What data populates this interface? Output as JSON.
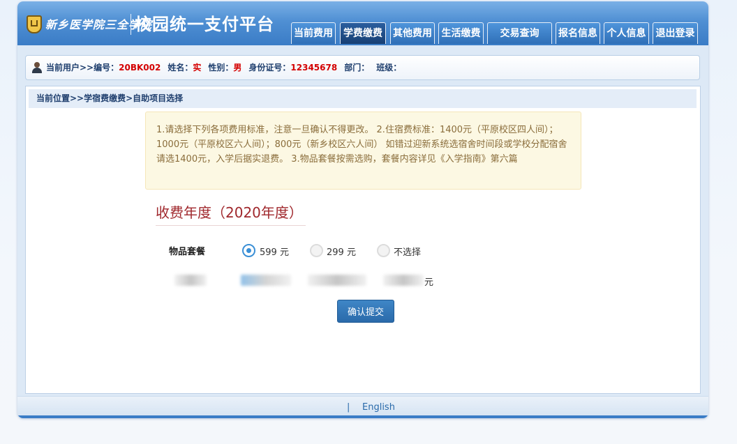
{
  "header": {
    "school_name": "新乡医学院三全学院",
    "platform_title": "校园统一支付平台"
  },
  "nav": {
    "tabs": [
      {
        "label": "当前费用",
        "active": false
      },
      {
        "label": "学费缴费",
        "active": true
      },
      {
        "label": "其他费用",
        "active": false
      },
      {
        "label": "生活缴费",
        "active": false
      },
      {
        "label": "交易查询",
        "active": false
      },
      {
        "label": "报名信息",
        "active": false
      },
      {
        "label": "个人信息",
        "active": false
      },
      {
        "label": "退出登录",
        "active": false
      }
    ]
  },
  "user": {
    "prefix": "当前用户>>编号：",
    "id": "20BK002",
    "name_label": "姓名：",
    "name": "实",
    "gender_label": "性别：",
    "gender": "男",
    "idcard_label": "身份证号：",
    "idcard": "12345678",
    "dept_label": "部门：",
    "class_label": "班级："
  },
  "breadcrumb": "当前位置>>学宿费缴费>自助项目选择",
  "notice": "1.请选择下列各项费用标准，注意一旦确认不得更改。 2.住宿费标准：1400元（平原校区四人间）；1000元（平原校区六人间）；800元（新乡校区六人间） 如错过迎新系统选宿舍时间段或学校分配宿舍请选1400元，入学后据实退费。 3.物品套餐按需选购，套餐内容详见《入学指南》第六篇",
  "fee_year": "收费年度（2020年度）",
  "goods_package": {
    "label": "物品套餐",
    "options": [
      {
        "label": "599 元",
        "checked": true
      },
      {
        "label": "299 元",
        "checked": false
      },
      {
        "label": "不选择",
        "checked": false
      }
    ]
  },
  "second_row_unit": "元",
  "submit_label": "确认提交",
  "footer": {
    "separator": "|",
    "language_link": "English"
  },
  "colors": {
    "header_blue": "#3a7cc6",
    "active_tab": "#1f4d86",
    "highlight_red": "#d40000",
    "fee_year_red": "#a0282d",
    "notice_bg": "#fcf8e3",
    "radio_blue": "#3a8fd6"
  }
}
